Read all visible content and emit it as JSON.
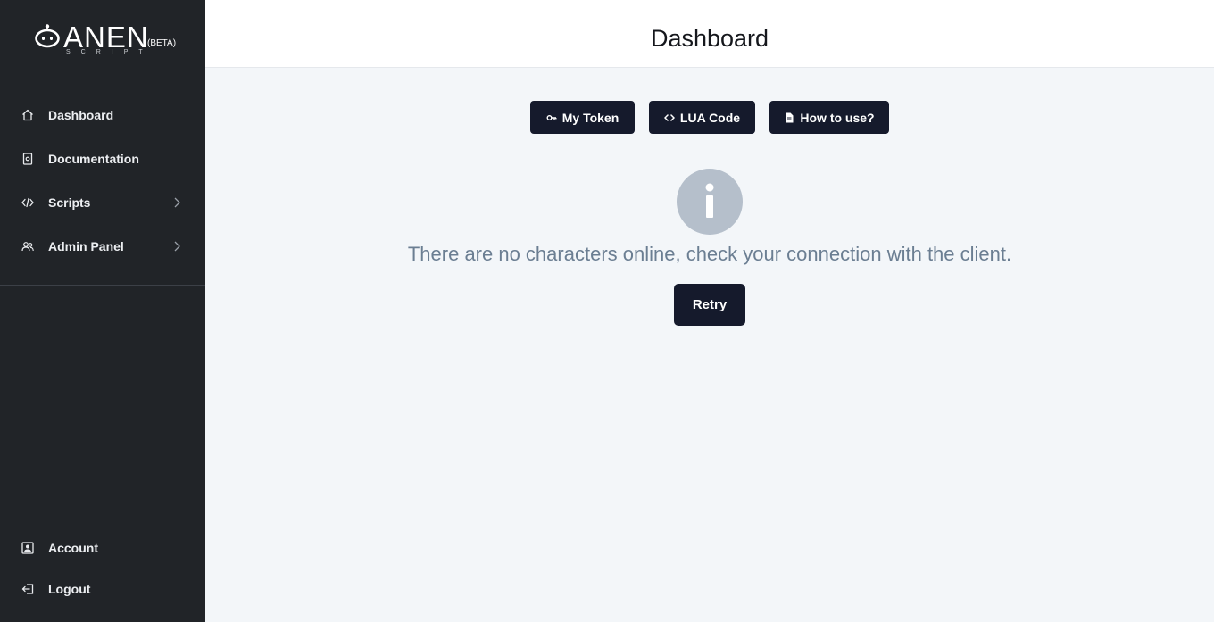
{
  "brand": {
    "name": "ANEN",
    "subtitle": "SCRIPT",
    "badge": "(BETA)"
  },
  "sidebar": {
    "items": [
      {
        "label": "Dashboard",
        "icon": "home-icon"
      },
      {
        "label": "Documentation",
        "icon": "document-icon"
      },
      {
        "label": "Scripts",
        "icon": "code-icon",
        "has_submenu": true
      },
      {
        "label": "Admin Panel",
        "icon": "users-icon",
        "has_submenu": true
      }
    ],
    "bottom_items": [
      {
        "label": "Account",
        "icon": "account-icon"
      },
      {
        "label": "Logout",
        "icon": "logout-icon"
      }
    ]
  },
  "header": {
    "title": "Dashboard"
  },
  "toolbar": {
    "my_token_label": "My Token",
    "lua_code_label": "LUA Code",
    "how_to_use_label": "How to use?"
  },
  "main": {
    "message": "There are no characters online, check your connection with the client.",
    "retry_label": "Retry"
  },
  "colors": {
    "sidebar_bg": "#212428",
    "button_bg": "#151a2c",
    "content_bg": "#f3f6f9",
    "info_circle": "#b5bfcb",
    "message_text": "#6b7e92"
  }
}
